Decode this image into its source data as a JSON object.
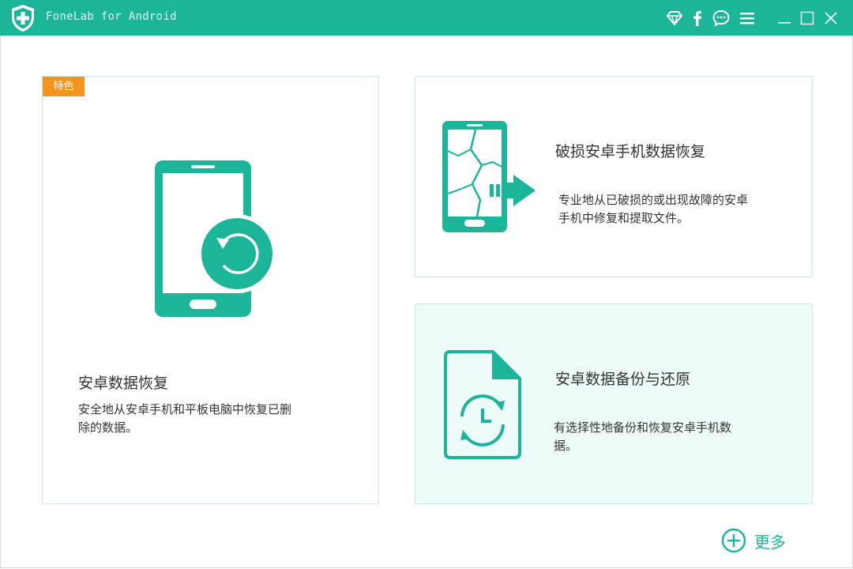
{
  "app": {
    "title": "FoneLab for Android",
    "brand_color": "#1bb59a",
    "badge_color": "#f7941d"
  },
  "titlebar_icons": [
    "diamond-icon",
    "facebook-icon",
    "chat-icon",
    "menu-icon",
    "minimize-icon",
    "maximize-icon",
    "close-icon"
  ],
  "cards": {
    "main": {
      "badge": "特色",
      "title": "安卓数据恢复",
      "desc_line1": "安全地从安卓手机和平板电脑中恢复已删",
      "desc_line2": "除的数据。",
      "icon": "phone-restore-icon"
    },
    "broken": {
      "title": "破损安卓手机数据恢复",
      "desc_line1": "专业地从已破损的或出现故障的安卓",
      "desc_line2": "手机中修复和提取文件。",
      "icon": "broken-phone-icon"
    },
    "backup": {
      "title": "安卓数据备份与还原",
      "desc_line1": "有选择性地备份和恢复安卓手机数",
      "desc_line2": "据。",
      "icon": "file-backup-icon"
    }
  },
  "more": {
    "label": "更多",
    "icon": "plus-circle-icon"
  }
}
